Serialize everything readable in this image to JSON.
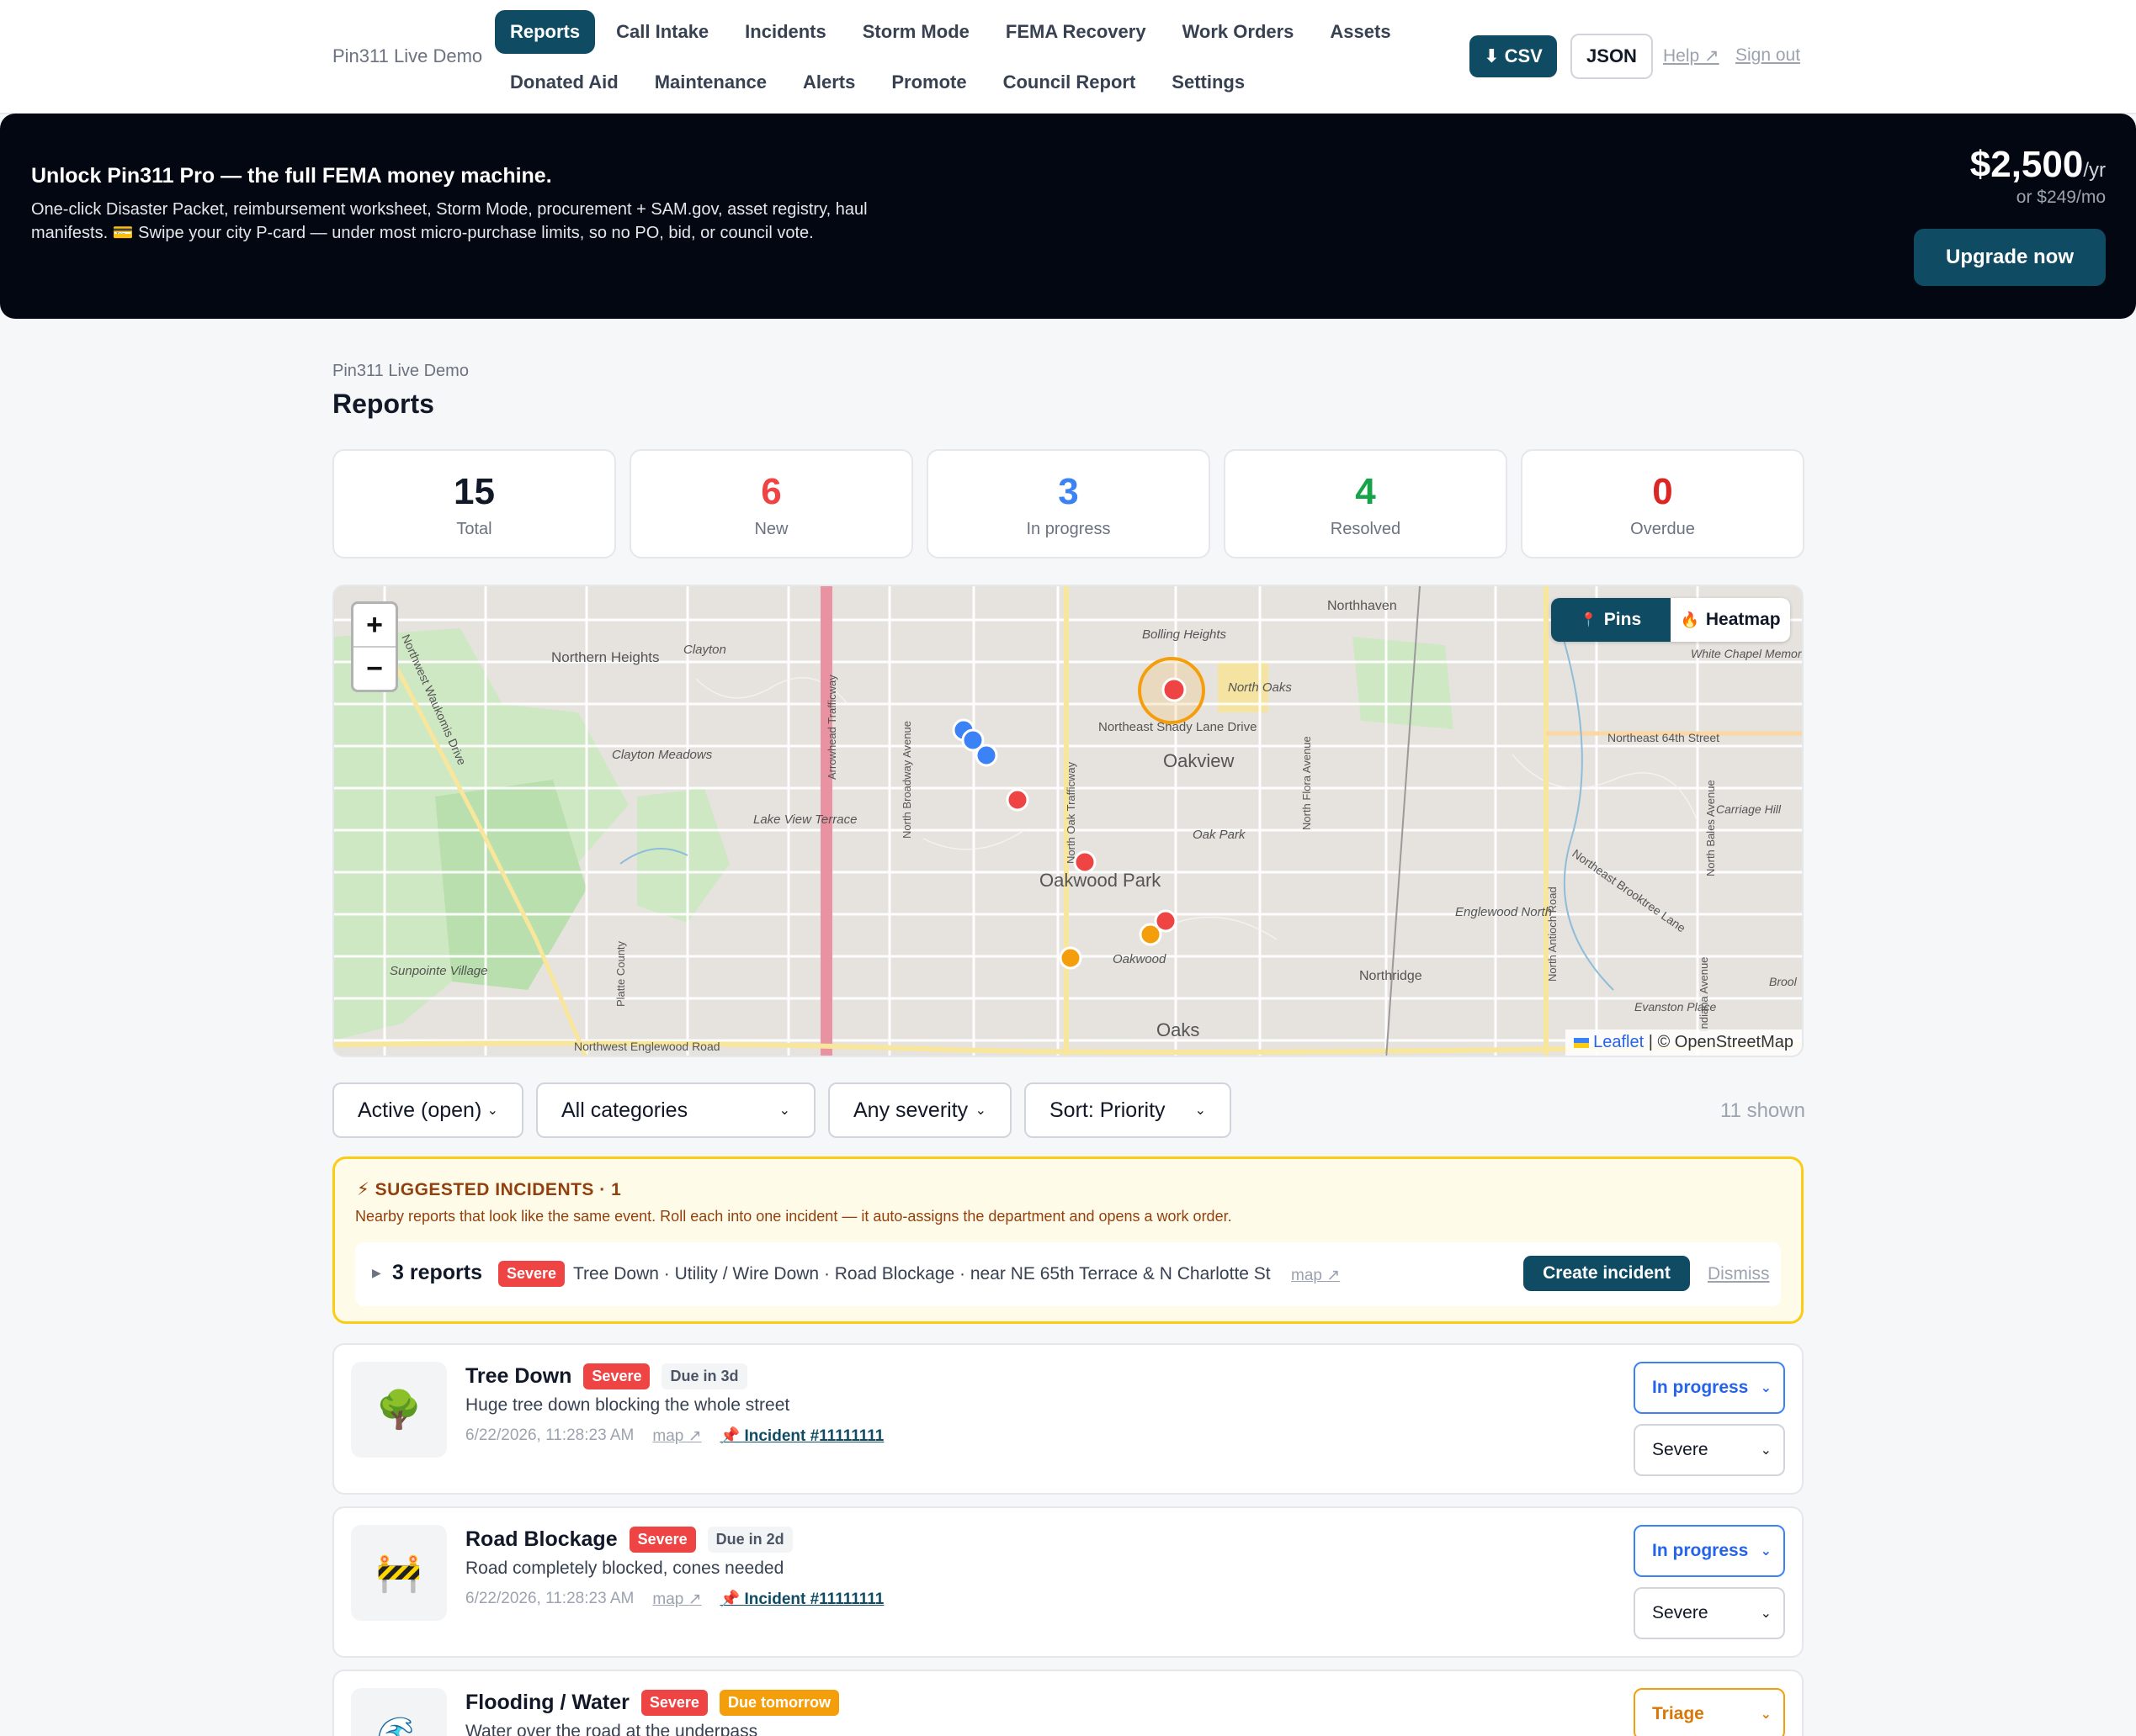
{
  "brand": "Pin311 Live Demo",
  "nav": {
    "row1": [
      "Reports",
      "Call Intake",
      "Incidents",
      "Storm Mode",
      "FEMA Recovery",
      "Work Orders",
      "Assets"
    ],
    "row2": [
      "Donated Aid",
      "Maintenance",
      "Alerts",
      "Promote",
      "Council Report",
      "Settings"
    ],
    "active": "Reports",
    "csv_label": "CSV",
    "json_label": "JSON",
    "help_label": "Help ↗",
    "signout_label": "Sign out"
  },
  "promo": {
    "title": "Unlock Pin311 Pro — the full FEMA money machine.",
    "text": "One-click Disaster Packet, reimbursement worksheet, Storm Mode, procurement + SAM.gov, asset registry, haul manifests. 💳 Swipe your city P-card — under most micro-purchase limits, so no PO, bid, or council vote.",
    "price": "$2,500",
    "price_unit": "/yr",
    "price_alt": "or $249/mo",
    "cta": "Upgrade now"
  },
  "page": {
    "crumb": "Pin311 Live Demo",
    "title": "Reports"
  },
  "stats": [
    {
      "value": "15",
      "label": "Total",
      "color": "#111827"
    },
    {
      "value": "6",
      "label": "New",
      "color": "#ef4444"
    },
    {
      "value": "3",
      "label": "In progress",
      "color": "#3b82f6"
    },
    {
      "value": "4",
      "label": "Resolved",
      "color": "#16a34a"
    },
    {
      "value": "0",
      "label": "Overdue",
      "color": "#dc2626"
    }
  ],
  "map": {
    "zoom_in": "+",
    "zoom_out": "−",
    "pins_label": "Pins",
    "heatmap_label": "Heatmap",
    "attribution_leaflet": "Leaflet",
    "attribution_osm": "| © OpenStreetMap",
    "place_labels": [
      "Northern Heights",
      "Clayton",
      "Clayton Meadows",
      "Lake View Terrace",
      "Bolling Heights",
      "North Oaks",
      "Northeast Shady Lane Drive",
      "Oakview",
      "Oak Park",
      "Oakwood Park",
      "Oakwood",
      "Oaks",
      "Northhaven",
      "White Chapel Memorial Gardens",
      "Northeast 64th Street",
      "Carriage Hill",
      "Northeast Brooktree Lane",
      "Englewood North",
      "Northridge",
      "Evanston Place",
      "Sunpointe Village",
      "Northwest Englewood Road",
      "Arrowhead Trafficway",
      "North Broadway Avenue",
      "North Oak Trafficway",
      "North Flora Avenue",
      "North Antioch Road",
      "North Bales Avenue",
      "Indiana Avenue",
      "Northwest Waukomis Drive",
      "Platte County",
      "Brool"
    ]
  },
  "filters": {
    "status": "Active (open)",
    "category": "All categories",
    "severity": "Any severity",
    "sort": "Sort: Priority",
    "shown": "11 shown"
  },
  "suggested": {
    "heading": "⚡ SUGGESTED INCIDENTS · 1",
    "desc": "Nearby reports that look like the same event. Roll each into one incident — it auto-assigns the department and opens a work order.",
    "count": "3 reports",
    "severity": "Severe",
    "categories": "Tree Down · Utility / Wire Down · Road Blockage · near NE 65th Terrace & N Charlotte St",
    "map_link": "map ↗",
    "create": "Create incident",
    "dismiss": "Dismiss"
  },
  "reports": [
    {
      "icon": "🌳",
      "title": "Tree Down",
      "severity": "Severe",
      "due": "Due in 3d",
      "desc": "Huge tree down blocking the whole street",
      "time": "6/22/2026, 11:28:23 AM",
      "map": "map ↗",
      "incident": "📌 Incident #11111111",
      "status": "In progress",
      "sev_select": "Severe"
    },
    {
      "icon": "🚧",
      "title": "Road Blockage",
      "severity": "Severe",
      "due": "Due in 2d",
      "desc": "Road completely blocked, cones needed",
      "time": "6/22/2026, 11:28:23 AM",
      "map": "map ↗",
      "incident": "📌 Incident #11111111",
      "status": "In progress",
      "sev_select": "Severe"
    },
    {
      "icon": "🌊",
      "title": "Flooding / Water",
      "severity": "Severe",
      "due": "Due tomorrow",
      "desc": "Water over the road at the underpass",
      "time": "",
      "map": "",
      "incident": "",
      "status": "Triage",
      "sev_select": ""
    }
  ]
}
